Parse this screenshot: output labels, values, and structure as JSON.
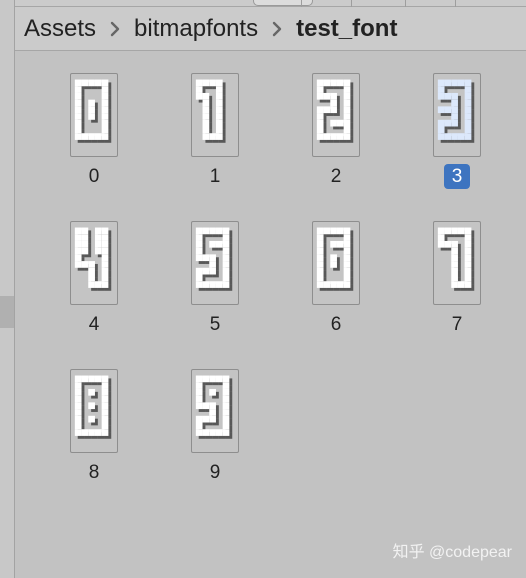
{
  "breadcrumb": {
    "items": [
      {
        "label": "Assets"
      },
      {
        "label": "bitmapfonts"
      },
      {
        "label": "test_font"
      }
    ]
  },
  "assets": [
    {
      "label": "0",
      "selected": false
    },
    {
      "label": "1",
      "selected": false
    },
    {
      "label": "2",
      "selected": false
    },
    {
      "label": "3",
      "selected": true
    },
    {
      "label": "4",
      "selected": false
    },
    {
      "label": "5",
      "selected": false
    },
    {
      "label": "6",
      "selected": false
    },
    {
      "label": "7",
      "selected": false
    },
    {
      "label": "8",
      "selected": false
    },
    {
      "label": "9",
      "selected": false
    }
  ],
  "colors": {
    "selection": "#3d74c0",
    "selected_glyph_fill": "#dce8fb",
    "glyph_fill": "#ffffff",
    "glyph_stroke": "#111111"
  },
  "watermark": "知乎 @codepear"
}
